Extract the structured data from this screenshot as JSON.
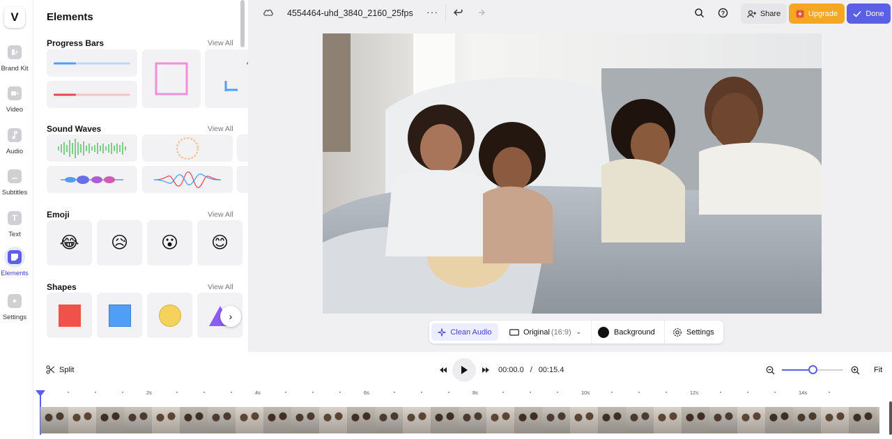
{
  "app": {
    "brand_color": "#5b5fe6",
    "logo_letter": "V",
    "file_name": "4554464-uhd_3840_2160_25fps"
  },
  "rail": [
    {
      "label": "Brand Kit",
      "icon": "brand-kit-icon"
    },
    {
      "label": "Video",
      "icon": "video-icon"
    },
    {
      "label": "Audio",
      "icon": "music-note-icon"
    },
    {
      "label": "Subtitles",
      "icon": "subtitles-icon"
    },
    {
      "label": "Text",
      "icon": "text-icon"
    },
    {
      "label": "Elements",
      "icon": "elements-icon",
      "active": true
    },
    {
      "label": "Settings",
      "icon": "settings-icon"
    }
  ],
  "panel": {
    "title": "Elements",
    "view_all": "View All",
    "sections": {
      "progress_bars": "Progress Bars",
      "sound_waves": "Sound Waves",
      "emoji": "Emoji",
      "shapes": "Shapes"
    },
    "emojis": [
      "😂",
      "😥",
      "😮",
      "😊"
    ],
    "shape_colors": [
      "#f0524a",
      "#4f9ff7",
      "#f5d25b",
      "#8b5cf6"
    ]
  },
  "topbar": {
    "share": "Share",
    "upgrade": "Upgrade",
    "done": "Done",
    "upgrade_color": "#f5a623",
    "done_color": "#5b5fe6"
  },
  "canvas_toolbar": {
    "clean_audio": "Clean Audio",
    "aspect": "Original",
    "aspect_ratio": "(16:9)",
    "background": "Background",
    "settings": "Settings"
  },
  "playback": {
    "split": "Split",
    "current_time": "00:00.0",
    "separator": "/",
    "total_time": "00:15.4",
    "fit": "Fit",
    "zoom_level": 0.5
  },
  "ruler": {
    "labels": [
      "2s",
      "4s",
      "6s",
      "8s",
      "10s",
      "12s",
      "14s"
    ]
  }
}
